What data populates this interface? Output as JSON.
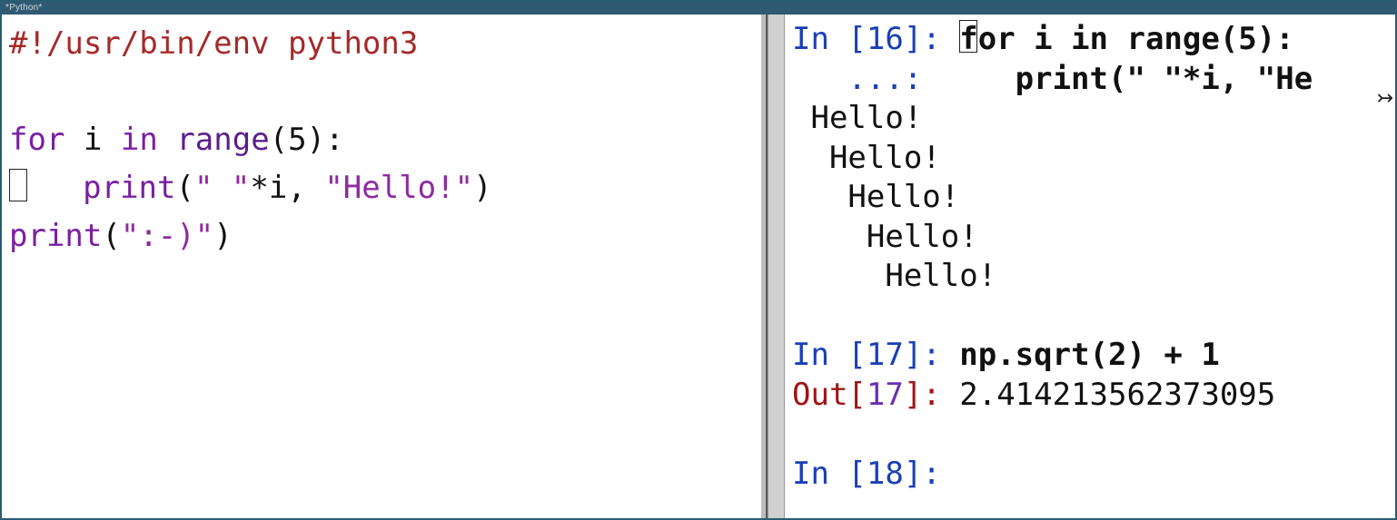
{
  "title": "*Python*",
  "editor": {
    "shebang": "#!/usr/bin/env python3",
    "kw_for": "for",
    "var_i": "i",
    "kw_in": "in",
    "fn_range": "range",
    "paren_open": "(",
    "num_5": "5",
    "paren_close_colon": "):",
    "blank_line": "",
    "fn_print": "print",
    "str_space": "\" \"",
    "star": "*",
    "var_i2": "i",
    "comma_sp": ", ",
    "str_hello": "\"Hello!\"",
    "close_paren": ")",
    "fn_print2": "print",
    "str_smile": "\":-)\"",
    "close_paren2": ")"
  },
  "repl": {
    "in16_label": "In [",
    "in16_num": "16",
    "in16_close": "]: ",
    "in16_code1": "for i in range(5):",
    "cont_label": "   ...: ",
    "in16_code2a": "    print(\" \"*i, \"He",
    "out_lines": [
      " Hello!",
      "  Hello!",
      "   Hello!",
      "    Hello!",
      "     Hello!"
    ],
    "blank": "",
    "in17_label": "In [",
    "in17_num": "17",
    "in17_close": "]: ",
    "in17_code": "np.sqrt(2) + 1",
    "out17_label": "Out[",
    "out17_num": "17",
    "out17_close": "]: ",
    "out17_val": "2.414213562373095",
    "in18_label": "In [",
    "in18_num": "18",
    "in18_close": "]: "
  },
  "overflow_glyph": "↣"
}
